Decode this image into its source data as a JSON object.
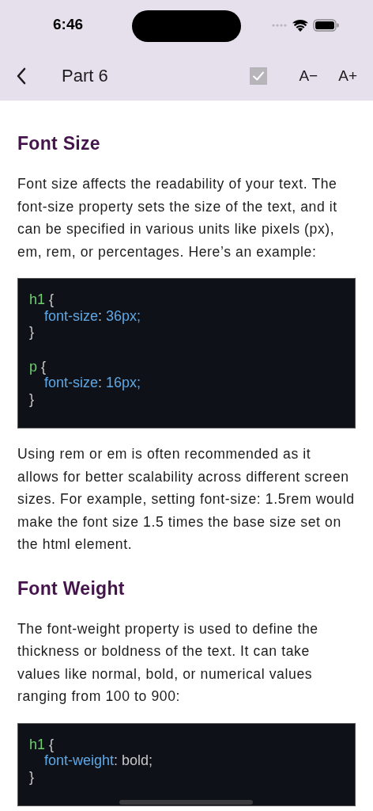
{
  "status_bar": {
    "time": "6:46"
  },
  "nav_bar": {
    "title": "Part 6",
    "mark_complete": {
      "checked": true
    },
    "buttons": [
      "A−",
      "A+"
    ]
  },
  "content": [
    {
      "kind": "heading",
      "text": "Font Size"
    },
    {
      "kind": "paragraph",
      "text": "Font size affects the readability of your text. The font-size property sets the size of the text, and it can be specified in various units like pixels (px), em, rem, or percentages. Here’s an example:"
    },
    {
      "kind": "code",
      "lines": [
        {
          "kind": "open",
          "tokens": [
            {
              "text": "h1",
              "kind": "selector"
            },
            {
              "text": " {",
              "kind": "punct"
            }
          ]
        },
        {
          "kind": "decl",
          "tokens": [
            {
              "text": "font-size",
              "kind": "property"
            },
            {
              "text": ": ",
              "kind": "punct"
            },
            {
              "text": "36px;",
              "kind": "number"
            }
          ]
        },
        {
          "kind": "close",
          "tokens": [
            {
              "text": "}",
              "kind": "punct"
            }
          ]
        },
        {
          "kind": "blank"
        },
        {
          "kind": "open",
          "tokens": [
            {
              "text": "p",
              "kind": "selector"
            },
            {
              "text": " {",
              "kind": "punct"
            }
          ]
        },
        {
          "kind": "decl",
          "tokens": [
            {
              "text": "font-size",
              "kind": "property"
            },
            {
              "text": ": ",
              "kind": "punct"
            },
            {
              "text": "16px;",
              "kind": "number"
            }
          ]
        },
        {
          "kind": "close",
          "tokens": [
            {
              "text": "}",
              "kind": "punct"
            }
          ]
        }
      ]
    },
    {
      "kind": "paragraph",
      "text": "Using rem or em is often recommended as it allows for better scalability across different screen sizes. For example, setting font-size: 1.5rem would make the font size 1.5 times the base size set on the html element."
    },
    {
      "kind": "heading",
      "text": "Font Weight"
    },
    {
      "kind": "paragraph",
      "text": "The font-weight property is used to define the thickness or boldness of the text. It can take values like normal, bold, or numerical values ranging from 100 to 900:"
    },
    {
      "kind": "code",
      "lines": [
        {
          "kind": "open",
          "tokens": [
            {
              "text": "h1",
              "kind": "selector"
            },
            {
              "text": " {",
              "kind": "punct"
            }
          ]
        },
        {
          "kind": "decl",
          "tokens": [
            {
              "text": "font-weight",
              "kind": "property"
            },
            {
              "text": ": bold;",
              "kind": "punct"
            }
          ]
        },
        {
          "kind": "close",
          "tokens": [
            {
              "text": "}",
              "kind": "punct"
            }
          ]
        }
      ]
    }
  ]
}
